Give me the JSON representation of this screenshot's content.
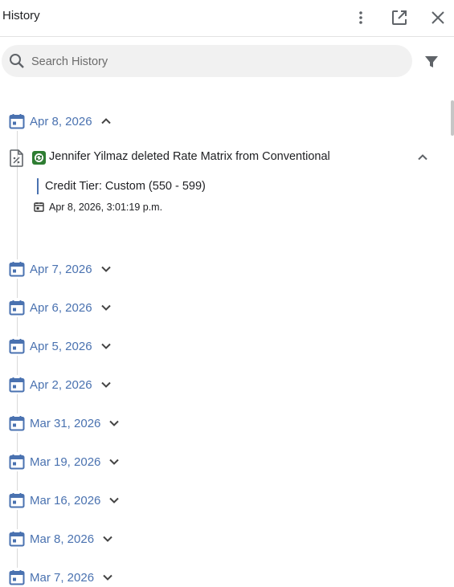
{
  "header": {
    "title": "History",
    "more_icon": "more-vert-icon",
    "popout_icon": "open-in-new-icon",
    "close_icon": "close-icon"
  },
  "search": {
    "placeholder": "Search History",
    "value": "",
    "icon": "search-icon",
    "filter_icon": "filter-icon"
  },
  "colors": {
    "accent": "#4a72b0",
    "search_bg": "#f1f1f1",
    "timeline": "#d9d9d9"
  },
  "days": [
    {
      "label": "Apr 8, 2026",
      "expanded": true
    },
    {
      "label": "Apr 7, 2026",
      "expanded": false
    },
    {
      "label": "Apr 6, 2026",
      "expanded": false
    },
    {
      "label": "Apr 5, 2026",
      "expanded": false
    },
    {
      "label": "Apr 2, 2026",
      "expanded": false
    },
    {
      "label": "Mar 31, 2026",
      "expanded": false
    },
    {
      "label": "Mar 19, 2026",
      "expanded": false
    },
    {
      "label": "Mar 16, 2026",
      "expanded": false
    },
    {
      "label": "Mar 8, 2026",
      "expanded": false
    },
    {
      "label": "Mar 7, 2026",
      "expanded": false
    }
  ],
  "event": {
    "summary": "Jennifer Yilmaz deleted Rate Matrix from Conventional",
    "change": "Credit Tier: Custom (550 - 599)",
    "timestamp": "Apr 8, 2026, 3:01:19 p.m.",
    "icon": "rate-document-icon",
    "app_icon": "app-logo-icon"
  }
}
